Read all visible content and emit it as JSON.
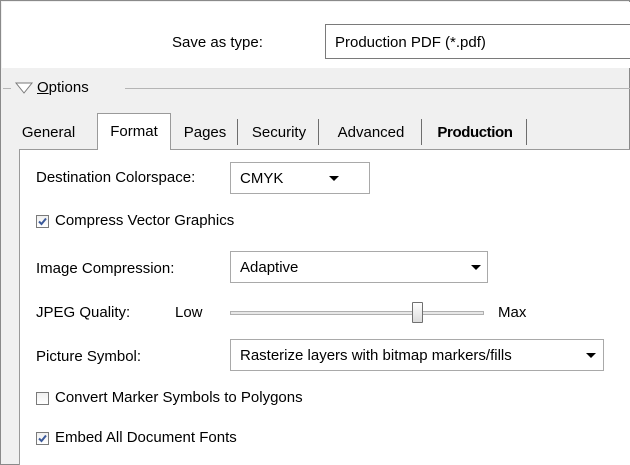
{
  "save": {
    "label": "Save as type:",
    "value": "Production PDF (*.pdf)"
  },
  "options": {
    "label_first": "O",
    "label_rest": "ptions",
    "expanded": true
  },
  "tabs": [
    {
      "label": "General",
      "active": false
    },
    {
      "label": "Format",
      "active": true
    },
    {
      "label": "Pages",
      "active": false
    },
    {
      "label": "Security",
      "active": false
    },
    {
      "label": "Advanced",
      "active": false
    },
    {
      "label": "Production",
      "active": false,
      "bold": true
    }
  ],
  "form": {
    "colorspace": {
      "label": "Destination Colorspace:",
      "value": "CMYK"
    },
    "compress_vector": {
      "label": "Compress Vector Graphics",
      "checked": true
    },
    "image_compression": {
      "label": "Image Compression:",
      "value": "Adaptive"
    },
    "jpeg_quality": {
      "label": "JPEG Quality:",
      "low": "Low",
      "high": "Max",
      "level": 0.75
    },
    "picture_symbol": {
      "label": "Picture Symbol:",
      "value": "Rasterize layers with bitmap markers/fills"
    },
    "convert_marker": {
      "label": "Convert Marker Symbols to Polygons",
      "checked": false
    },
    "embed_fonts": {
      "label": "Embed All Document Fonts",
      "checked": true
    }
  },
  "colors": {
    "check_blue": "#3c5a9a",
    "dialog_bg": "#f0f0f0"
  }
}
